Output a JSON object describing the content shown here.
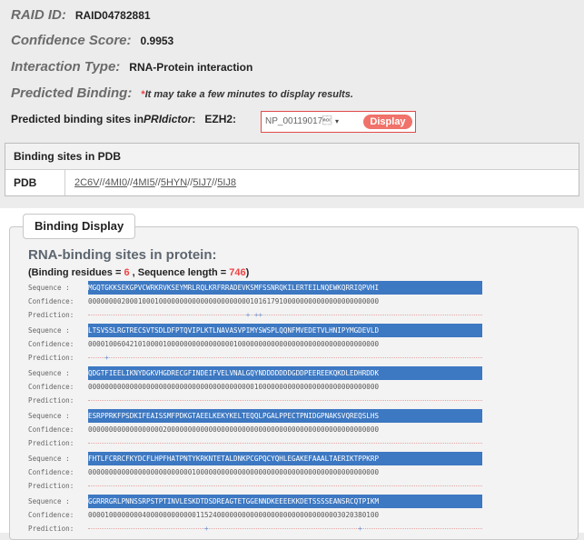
{
  "info": {
    "raid_label": "RAID ID:",
    "raid_value": "RAID04782881",
    "conf_label": "Confidence Score:",
    "conf_value": "0.9953",
    "type_label": "Interaction Type:",
    "type_value": "RNA-Protein interaction",
    "pred_label": "Predicted Binding:",
    "pred_note_ast": "*",
    "pred_note": "It may take a few minutes to display results."
  },
  "pri": {
    "label_prefix": "Predicted binding sites in ",
    "label_italic": "PRIdictor",
    "label_suffix": ":",
    "gene": "EZH2:",
    "select_value": "NP_00119017\u0006",
    "select_caret": "▾",
    "button": "Display"
  },
  "pdb": {
    "section_title": "Binding sites in PDB",
    "row_label": "PDB",
    "links": [
      "2C6V",
      "4MI0",
      "4MI5",
      "5HYN",
      "5IJ7",
      "5IJ8"
    ],
    "separator": "//"
  },
  "display": {
    "legend": "Binding Display",
    "title": "RNA-binding sites in protein:",
    "summary_prefix": "(Binding residues = ",
    "binding_residues": "6",
    "summary_mid": " , Sequence length = ",
    "sequence_length": "746",
    "summary_suffix": ")",
    "labels": {
      "sequence": "Sequence   :",
      "confidence": "Confidence:",
      "prediction": "Prediction:"
    },
    "blocks": [
      {
        "sequence": "MGQTGKKSEKGPVCWRKRVKSEYMRLRQLKRFRRADEVKSMFSSNRQKILERTEILNQEWKQRRIQPVHI",
        "confidence": "0000000020001000100000000000000000000001016179100000000000000000000000",
        "prediction": "                                      + ++                            "
      },
      {
        "sequence": "LTSVSSLRGTRECSVTSDLDFPTQVIPLKTLNAVASVPIMYSWSPLQQNFMVEDETVLHNIPYMGDEVLD",
        "confidence": "0000100604210100001000000000000000010000000000000000000000000000000000",
        "prediction": "    +                                                                 "
      },
      {
        "sequence": "QDGTFIEELIKNYDGKVHGDRECGFINDEIFVELVNALGQYNDDDDDDDGDDPEEREEKQKDLEDHRDDK",
        "confidence": "0000000000000000000000000000000000000000100000000000000000000000000000",
        "prediction": "                                                                      "
      },
      {
        "sequence": "ESRPPRKFPSDKIFEAISSMFPDKGTAEELKEKYKELTEQQLPGALPPECTPNIDGPNAKSVQREQSLHS",
        "confidence": "0000000000000000002000000000000000000000000000000000000000000000000000",
        "prediction": "                                                                      "
      },
      {
        "sequence": "FHTLFCRRCFKYDCFLHPFHATPNTYKRKNTETALDNKPCGPQCYQHLEGAKEFAAALTAERIKTPPKRP",
        "confidence": "0000000000000000000000000100000000000000000000000000000000000000000000",
        "prediction": "                                                                      "
      },
      {
        "sequence": "GGRRRGRLPNNSSRPSTPTINVLESKDTDSDREAGTETGGENNDKEEEEKKDETSSSSEANSRCQTPIKM",
        "confidence": "0000100000000400000000000011524000000000000000000000000000003020380100",
        "prediction": "                            +                                    +     "
      }
    ]
  }
}
